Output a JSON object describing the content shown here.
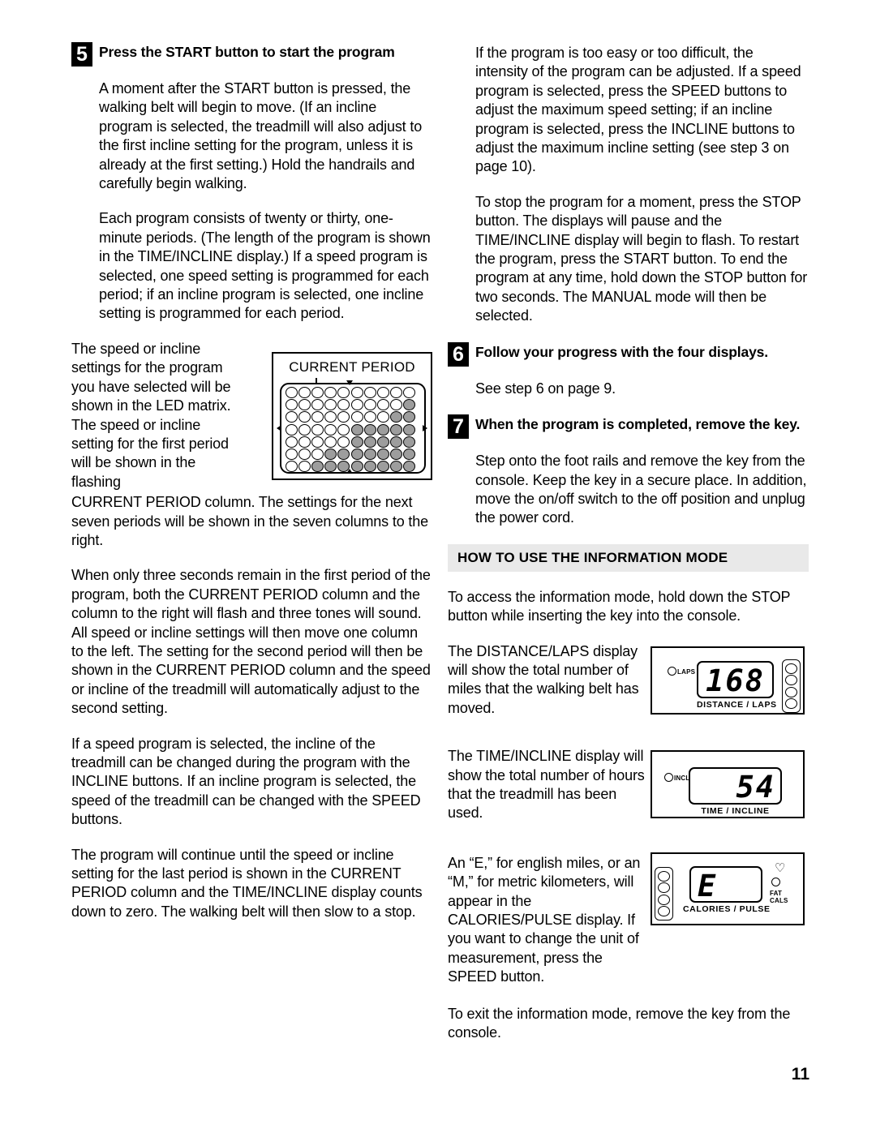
{
  "page": {
    "number": "11"
  },
  "steps": {
    "five": {
      "num": "5",
      "title": "Press the START button to start the program",
      "p1": "A moment after the START button is pressed, the walking belt will begin to move. (If an incline program is selected, the treadmill will also adjust to the first incline setting for the program, unless it is already at the first setting.) Hold the handrails and carefully begin walking.",
      "p2": "Each program consists of twenty or thirty, one-minute periods. (The length of the program is shown in the TIME/INCLINE display.) If a speed program is selected, one speed setting is programmed for each period; if an incline program is selected, one incline setting is programmed for each period.",
      "p3_wrap": "The speed or incline settings for the program you have selected will be shown in the LED matrix. The speed or incline setting for the first period will be shown in the flashing",
      "p3_rest": "CURRENT PERIOD column. The settings for the next seven periods will be shown in the seven columns to the right.",
      "p4": "When only three seconds remain in the first period of the program, both the CURRENT PERIOD column and the column to the right will flash and three tones will sound. All speed or incline settings will then move one column to the left. The setting for the second period will then be shown in the CURRENT PERIOD column and the speed or incline of the treadmill will automatically adjust to the second setting.",
      "p5": "If a speed program is selected, the incline of the treadmill can be changed during the program with the INCLINE buttons. If an incline program is selected, the speed of the treadmill can be changed with the SPEED buttons.",
      "p6": "The program will continue until the speed or incline setting for the last period is shown in the CURRENT PERIOD column and the TIME/INCLINE display counts down to zero. The walking belt will then slow to a stop."
    },
    "six": {
      "num": "6",
      "title": "Follow your progress with the four displays.",
      "p1": "See step 6 on page 9."
    },
    "seven": {
      "num": "7",
      "title": "When the program is completed, remove the key.",
      "p1": "Step onto the foot rails and remove the key from the console. Keep the key in a secure place. In addition, move the on/off switch to the off position and unplug the power cord."
    }
  },
  "right_top": {
    "p1": "If the program is too easy or too difficult, the intensity of the program can be adjusted. If a speed program is selected, press the SPEED buttons to adjust the maximum speed setting; if an incline program is selected, press the INCLINE buttons to adjust the maximum incline setting (see step 3 on page 10).",
    "p2": "To stop the program for a moment, press the STOP button. The displays will pause and the TIME/INCLINE display will begin to flash. To restart the program, press the START button. To end the program at any time, hold down the STOP button for two seconds. The MANUAL mode will then be selected."
  },
  "info_mode": {
    "heading": "HOW TO USE THE INFORMATION MODE",
    "intro": "To access the information mode, hold down the STOP button while inserting the key into the console.",
    "p_distance": "The DISTANCE/LAPS display will show the total number of miles that the walking belt has moved.",
    "p_time": "The TIME/INCLINE display will show the total number of hours that the treadmill has been used.",
    "p_calories": "An “E,” for english miles, or an “M,” for metric kilometers, will appear in the CALORIES/PULSE display. If you want to change the unit of measurement, press the SPEED    button.",
    "outro": "To exit the information mode, remove the key from the console."
  },
  "figure_current_period": {
    "label": "CURRENT PERIOD",
    "columns": 10,
    "rows": 7,
    "matrix": [
      [
        0,
        0,
        0,
        0,
        0,
        0,
        0,
        0,
        0,
        0
      ],
      [
        0,
        0,
        0,
        0,
        0,
        0,
        0,
        0,
        0,
        1
      ],
      [
        0,
        0,
        0,
        0,
        0,
        0,
        0,
        0,
        1,
        1
      ],
      [
        0,
        0,
        0,
        0,
        0,
        1,
        1,
        1,
        1,
        1
      ],
      [
        0,
        0,
        0,
        0,
        0,
        1,
        1,
        1,
        1,
        1
      ],
      [
        0,
        0,
        0,
        1,
        1,
        1,
        1,
        1,
        1,
        1
      ],
      [
        0,
        0,
        1,
        1,
        1,
        1,
        1,
        1,
        1,
        1
      ]
    ],
    "pointer_column": 3,
    "on_color": "#9d9d9d"
  },
  "displays": [
    {
      "name": "distance-laps",
      "value": "168",
      "caption": "DISTANCE / LAPS",
      "indicator": "LAPS"
    },
    {
      "name": "time-incline",
      "value": "54",
      "caption": "TIME / INCLINE",
      "indicator": "INCL"
    },
    {
      "name": "calories-pulse",
      "value": "E",
      "caption": "CALORIES / PULSE",
      "indicator_line1": "FAT",
      "indicator_line2": "CALS",
      "heart_icon": "♡"
    }
  ]
}
